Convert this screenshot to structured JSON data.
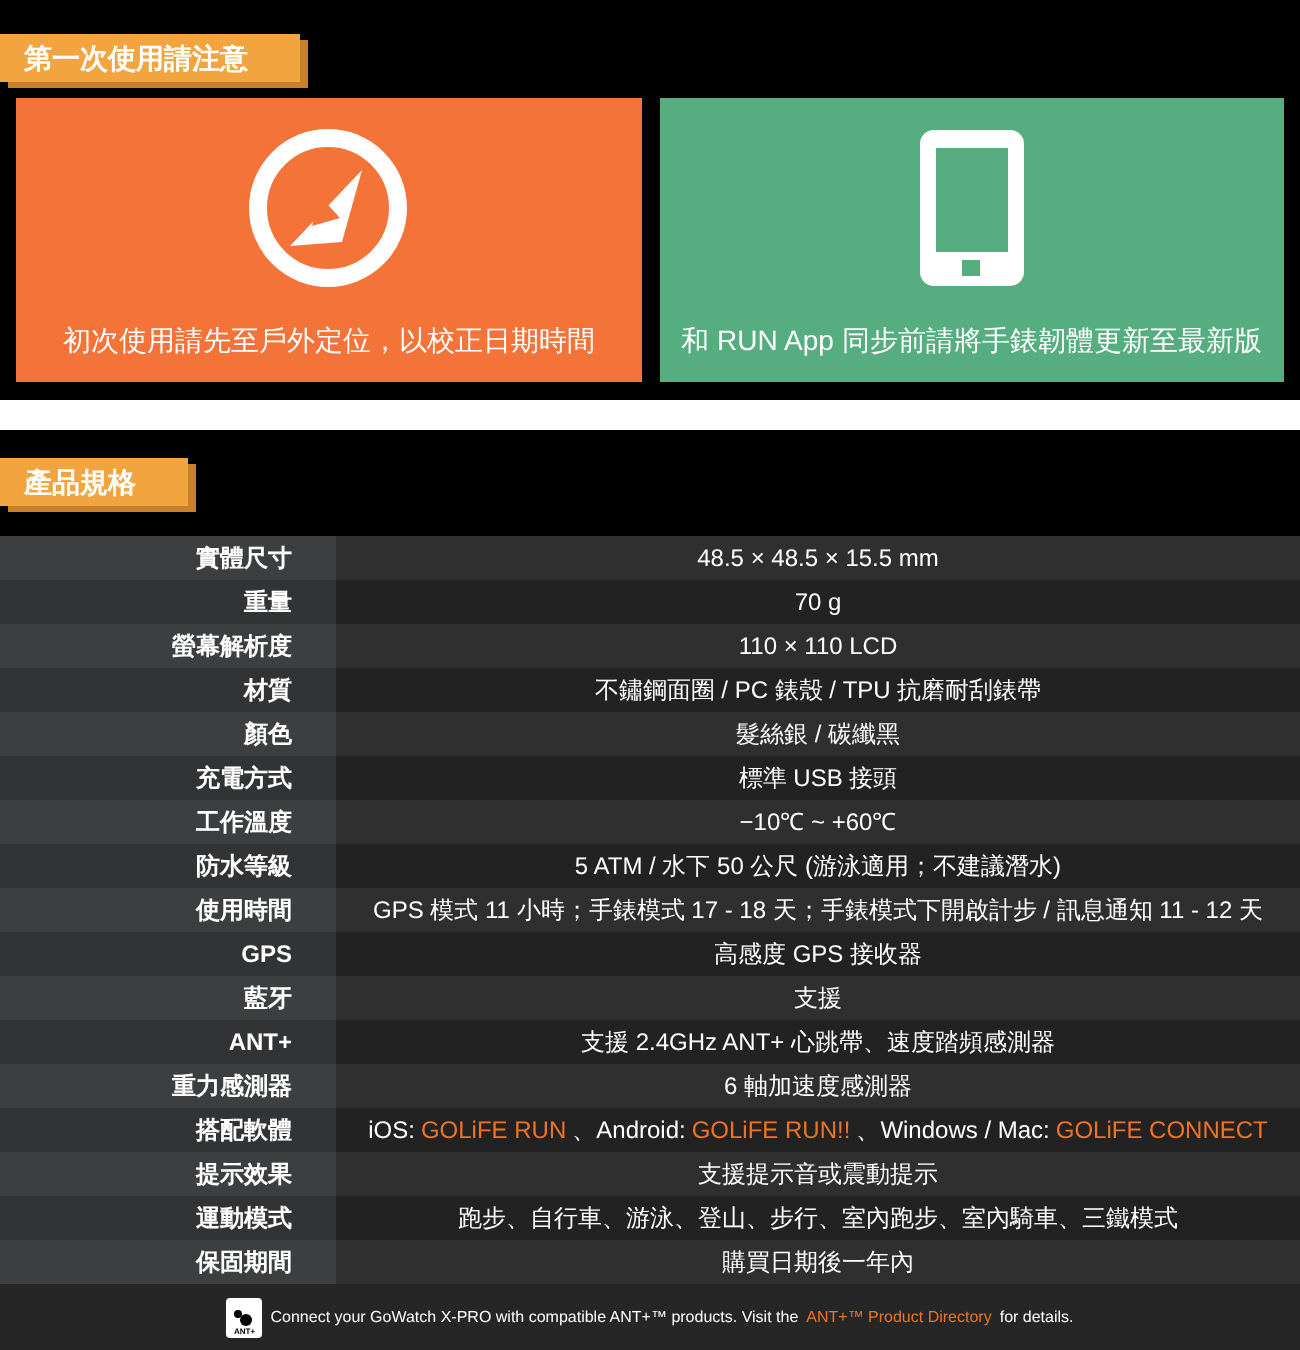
{
  "notice": {
    "title": "第一次使用請注意",
    "cards": [
      {
        "kind": "compass",
        "text": "初次使用請先至戶外定位，以校正日期時間"
      },
      {
        "kind": "phone",
        "text": "和 RUN App 同步前請將手錶韌體更新至最新版"
      }
    ]
  },
  "specs": {
    "title": "產品規格",
    "rows": [
      {
        "label": "實體尺寸",
        "value": [
          {
            "kind": "plain",
            "text": "48.5 × 48.5 × 15.5 mm"
          }
        ]
      },
      {
        "label": "重量",
        "value": [
          {
            "kind": "plain",
            "text": "70 g"
          }
        ]
      },
      {
        "label": "螢幕解析度",
        "value": [
          {
            "kind": "plain",
            "text": "110 × 110 LCD"
          }
        ]
      },
      {
        "label": "材質",
        "value": [
          {
            "kind": "plain",
            "text": "不鏽鋼面圈 / PC 錶殼 / TPU 抗磨耐刮錶帶"
          }
        ]
      },
      {
        "label": "顏色",
        "value": [
          {
            "kind": "plain",
            "text": "髮絲銀 / 碳纖黑"
          }
        ]
      },
      {
        "label": "充電方式",
        "value": [
          {
            "kind": "plain",
            "text": "標準 USB 接頭"
          }
        ]
      },
      {
        "label": "工作溫度",
        "value": [
          {
            "kind": "plain",
            "text": "−10℃ ~ +60℃"
          }
        ]
      },
      {
        "label": "防水等級",
        "value": [
          {
            "kind": "plain",
            "text": "5 ATM / 水下 50 公尺 (游泳適用；不建議潛水)"
          }
        ]
      },
      {
        "label": "使用時間",
        "value": [
          {
            "kind": "plain",
            "text": "GPS 模式 11 小時；手錶模式 17 - 18 天；手錶模式下開啟計步 / 訊息通知 11 - 12 天"
          }
        ]
      },
      {
        "label": "GPS",
        "value": [
          {
            "kind": "plain",
            "text": "高感度 GPS 接收器"
          }
        ]
      },
      {
        "label": "藍牙",
        "value": [
          {
            "kind": "plain",
            "text": "支援"
          }
        ]
      },
      {
        "label": "ANT+",
        "value": [
          {
            "kind": "plain",
            "text": "支援 2.4GHz ANT+ 心跳帶、速度踏頻感測器"
          }
        ]
      },
      {
        "label": "重力感測器",
        "value": [
          {
            "kind": "plain",
            "text": "6 軸加速度感測器"
          }
        ]
      },
      {
        "label": "搭配軟體",
        "value": [
          {
            "kind": "plain",
            "text": "iOS:"
          },
          {
            "kind": "link",
            "text": "GOLiFE RUN"
          },
          {
            "kind": "plain",
            "text": "、Android:"
          },
          {
            "kind": "link",
            "text": "GOLiFE RUN!!"
          },
          {
            "kind": "plain",
            "text": "、Windows / Mac:"
          },
          {
            "kind": "link",
            "text": "GOLiFE CONNECT"
          }
        ]
      },
      {
        "label": "提示效果",
        "value": [
          {
            "kind": "plain",
            "text": "支援提示音或震動提示"
          }
        ]
      },
      {
        "label": "運動模式",
        "value": [
          {
            "kind": "plain",
            "text": "跑步、自行車、游泳、登山、步行、室內跑步、室內騎車、三鐵模式"
          }
        ]
      },
      {
        "label": "保固期間",
        "value": [
          {
            "kind": "plain",
            "text": "購買日期後一年內"
          }
        ]
      }
    ]
  },
  "footer": {
    "logo_text": "ANT+",
    "text": "Connect your GoWatch X-PRO with compatible ANT+™ products. Visit the",
    "link": "ANT+™ Product Directory",
    "after": "for details."
  }
}
